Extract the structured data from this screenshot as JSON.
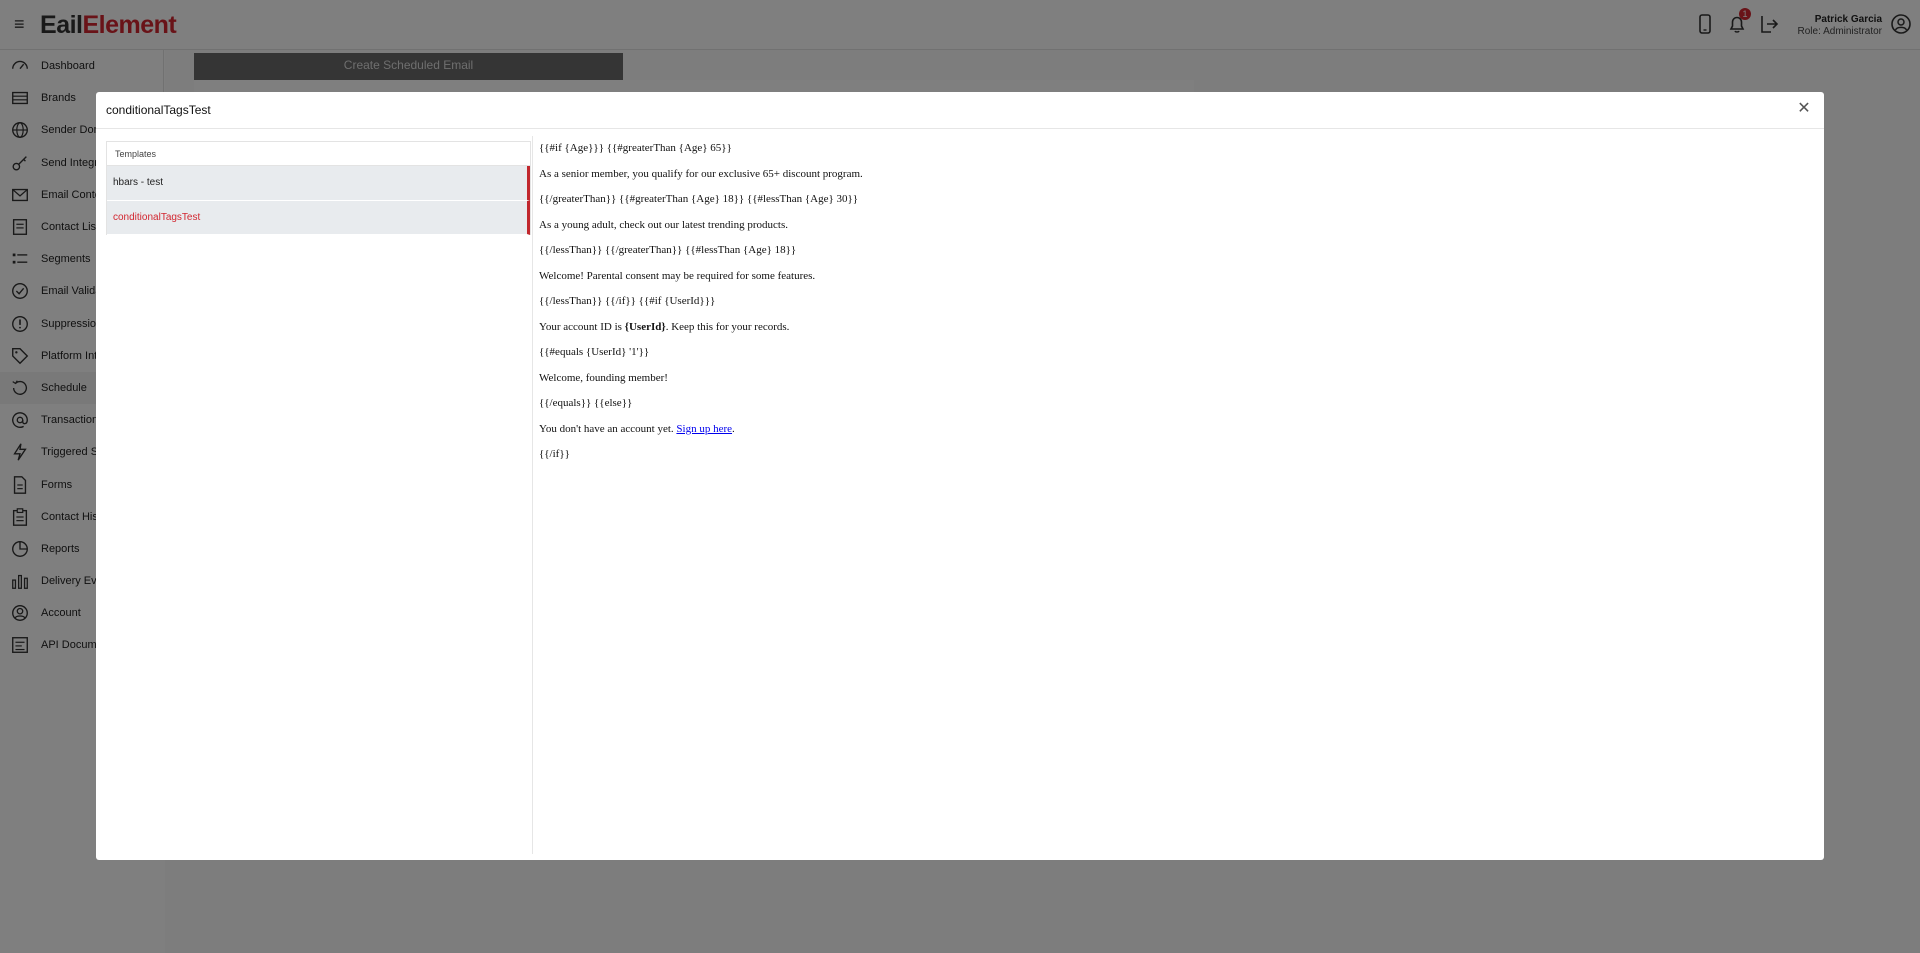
{
  "app": {
    "logo_part1": "E",
    "logo_part2": "ail",
    "logo_part3": "Element",
    "notification_count": "1"
  },
  "user": {
    "name": "Patrick Garcia",
    "role": "Role: Administrator"
  },
  "sidebar": {
    "items": [
      {
        "label": "Dashboard",
        "icon": "dashboard-icon"
      },
      {
        "label": "Brands",
        "icon": "brands-icon"
      },
      {
        "label": "Sender Dom",
        "icon": "globe-icon"
      },
      {
        "label": "Send Integr",
        "icon": "key-icon"
      },
      {
        "label": "Email Conte",
        "icon": "envelope-icon"
      },
      {
        "label": "Contact List",
        "icon": "contacts-icon"
      },
      {
        "label": "Segments",
        "icon": "segments-icon"
      },
      {
        "label": "Email Valida",
        "icon": "check-circle-icon"
      },
      {
        "label": "Suppressio",
        "icon": "alert-icon"
      },
      {
        "label": "Platform Int",
        "icon": "tag-icon"
      },
      {
        "label": "Schedule",
        "icon": "schedule-icon"
      },
      {
        "label": "Transaction",
        "icon": "at-icon"
      },
      {
        "label": "Triggered S",
        "icon": "bolt-icon"
      },
      {
        "label": "Forms",
        "icon": "form-icon"
      },
      {
        "label": "Contact His",
        "icon": "history-icon"
      },
      {
        "label": "Reports",
        "icon": "reports-icon"
      },
      {
        "label": "Delivery Eve",
        "icon": "chart-icon"
      },
      {
        "label": "Account",
        "icon": "account-icon"
      },
      {
        "label": "API Docum",
        "icon": "api-icon"
      }
    ]
  },
  "background": {
    "create_button": "Create Scheduled Email"
  },
  "modal": {
    "title": "conditionalTagsTest",
    "templates_header": "Templates",
    "templates": [
      {
        "label": "hbars - test",
        "selected": false
      },
      {
        "label": "conditionalTagsTest",
        "selected": true
      }
    ],
    "preview_lines": [
      "{{#if {Age}}} {{#greaterThan {Age} 65}}",
      "As a senior member, you qualify for our exclusive 65+ discount program.",
      "{{/greaterThan}} {{#greaterThan {Age} 18}} {{#lessThan {Age} 30}}",
      "As a young adult, check out our latest trending products.",
      "{{/lessThan}} {{/greaterThan}} {{#lessThan {Age} 18}}",
      "Welcome! Parental consent may be required for some features.",
      "{{/lessThan}} {{/if}} {{#if {UserId}}}",
      "{{#equals {UserId} '1'}}",
      "Welcome, founding member!",
      "{{/equals}} {{else}}",
      "{{/if}}"
    ],
    "account_line": {
      "prefix": "Your account ID is ",
      "bold": "{UserId}",
      "suffix": ". Keep this for your records."
    },
    "signup_line": {
      "prefix": "You don't have an account yet. ",
      "link": "Sign up here",
      "suffix": "."
    }
  },
  "colors": {
    "brand_red": "#d22630",
    "arrow_yellow": "#fbcf3c",
    "overlay": "rgba(0,0,0,0.5)"
  }
}
